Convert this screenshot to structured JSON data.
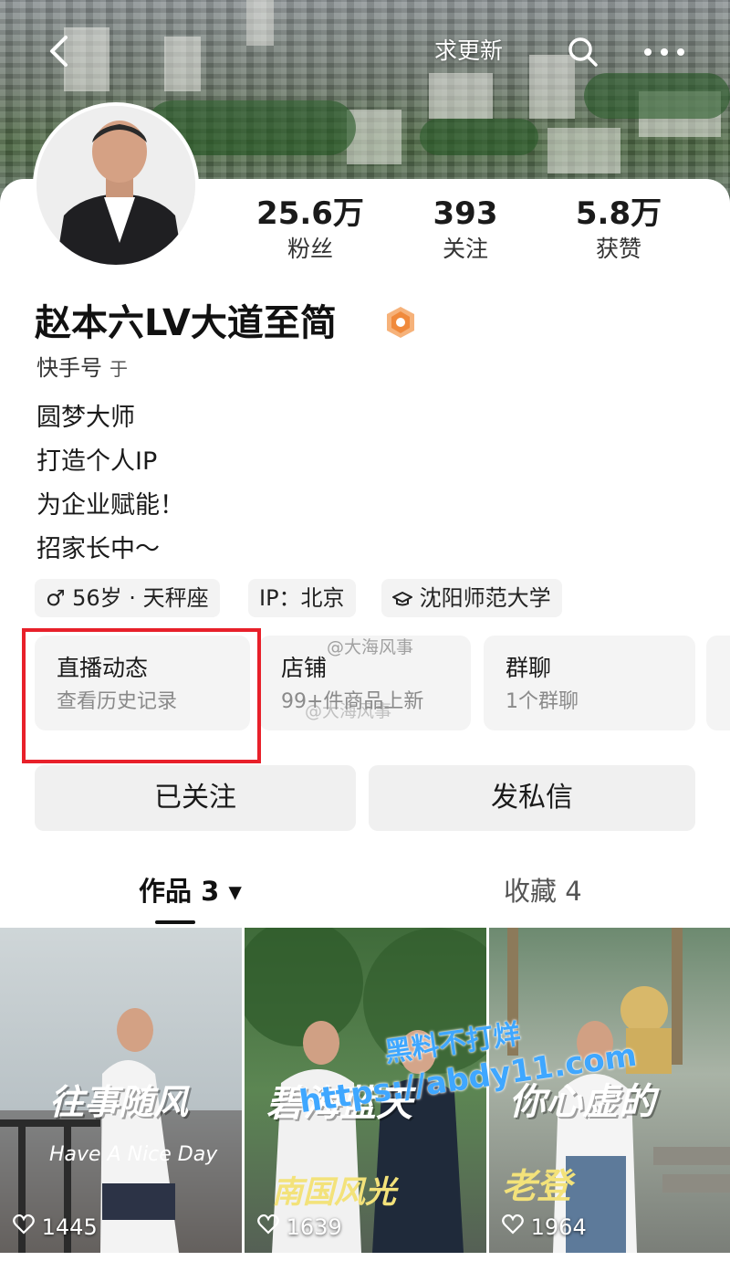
{
  "header": {
    "back_icon": "back-arrow-icon",
    "update_label": "求更新",
    "search_icon": "search-icon",
    "more_icon": "more-dots-icon"
  },
  "profile": {
    "name": "赵本六LV大道至简",
    "verified_icon": "verified-badge-icon",
    "kuaishou_id_label": "快手号",
    "kuaishou_id_value": "于",
    "stats": [
      {
        "value": "25.6万",
        "label": "粉丝"
      },
      {
        "value": "393",
        "label": "关注"
      },
      {
        "value": "5.8万",
        "label": "获赞"
      }
    ],
    "bio": [
      "圆梦大师",
      "打造个人IP",
      "为企业赋能！",
      "招家长中～"
    ],
    "tags": [
      {
        "text": "♂ 56岁 · 天秤座"
      },
      {
        "text": "IP：北京"
      },
      {
        "text": "沈阳师范大学"
      }
    ]
  },
  "entries": [
    {
      "title": "直播动态",
      "subtitle": "查看历史记录"
    },
    {
      "title": "店铺",
      "subtitle": "99+件商品上新"
    },
    {
      "title": "群聊",
      "subtitle": "1个群聊"
    }
  ],
  "actions": {
    "follow_label": "已关注",
    "message_label": "发私信"
  },
  "tabs": [
    {
      "label": "作品 3 ▾"
    },
    {
      "label": "收藏 4"
    }
  ],
  "videos": [
    {
      "caption": "往事随风",
      "subcaption": "Have A Nice Day",
      "likes": "1445"
    },
    {
      "caption": "碧海蓝天",
      "subcaption": "南国风光",
      "likes": "1639"
    },
    {
      "caption": "你心虚的",
      "subcaption": "老登",
      "likes": "1964"
    }
  ],
  "watermarks": {
    "weibo": "@大海风事",
    "weibo2": "@大海风事",
    "site_line1": "黑料不打烊",
    "site_line2": "https://abdy11.com"
  },
  "colors": {
    "highlight_box": "#e8202a",
    "badge_orange": "#f29a45",
    "watermark_blue": "#3fa7ff"
  }
}
